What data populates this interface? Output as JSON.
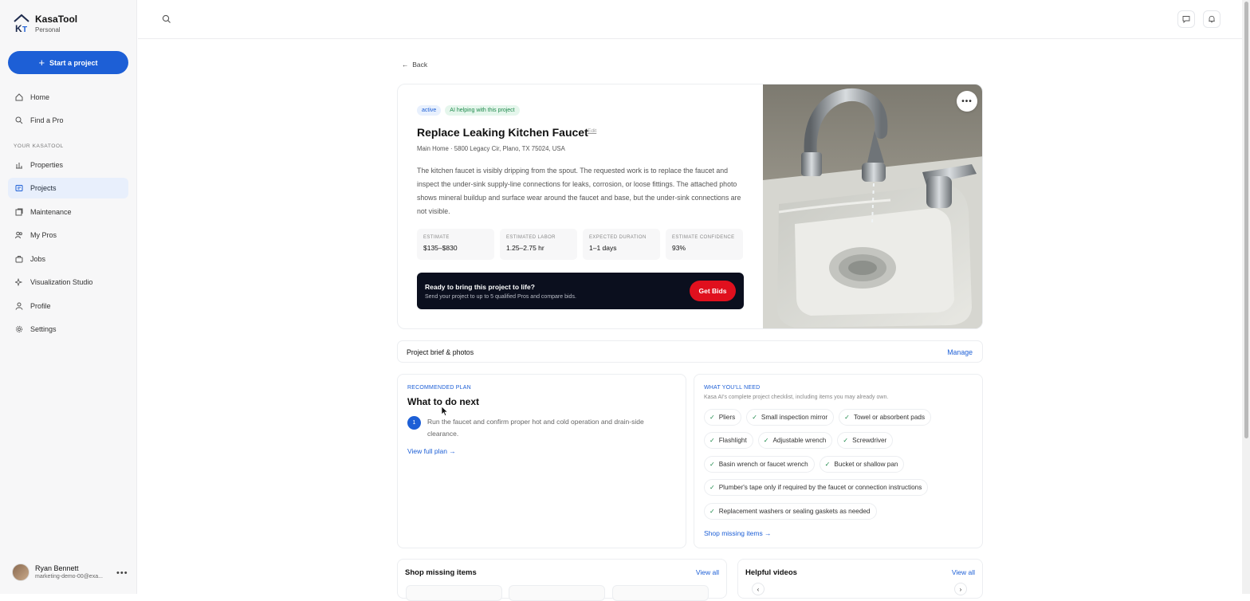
{
  "brand": {
    "name": "KasaTool",
    "subtitle": "Personal"
  },
  "sidebar": {
    "start_label": "Start a project",
    "section_label": "YOUR KASATOOL",
    "top_items": [
      {
        "label": "Home",
        "icon": "home-icon"
      },
      {
        "label": "Find a Pro",
        "icon": "search-icon"
      }
    ],
    "items": [
      {
        "label": "Properties",
        "icon": "chart-icon"
      },
      {
        "label": "Projects",
        "icon": "projects-icon",
        "active": true
      },
      {
        "label": "Maintenance",
        "icon": "maintenance-icon"
      },
      {
        "label": "My Pros",
        "icon": "users-icon"
      },
      {
        "label": "Jobs",
        "icon": "briefcase-icon"
      },
      {
        "label": "Visualization Studio",
        "icon": "sparkles-icon"
      },
      {
        "label": "Profile",
        "icon": "user-icon"
      },
      {
        "label": "Settings",
        "icon": "gear-icon"
      }
    ],
    "user": {
      "name": "Ryan Bennett",
      "email": "marketing-demo-00@exa..."
    }
  },
  "page": {
    "back_label": "Back",
    "badges": {
      "status": "active",
      "ai": "AI helping with this project"
    },
    "title": "Replace Leaking Kitchen Faucet",
    "edit_label": "Edit",
    "address": "Main Home · 5800 Legacy Cir, Plano, TX 75024, USA",
    "description": "The kitchen faucet is visibly dripping from the spout. The requested work is to replace the faucet and inspect the under-sink supply-line connections for leaks, corrosion, or loose fittings. The attached photo shows mineral buildup and surface wear around the faucet and base, but the under-sink connections are not visible.",
    "stats": [
      {
        "label": "ESTIMATE",
        "value": "$135–$830"
      },
      {
        "label": "ESTIMATED LABOR",
        "value": "1.25–2.75 hr"
      },
      {
        "label": "EXPECTED DURATION",
        "value": "1–1 days"
      },
      {
        "label": "ESTIMATE CONFIDENCE",
        "value": "93%"
      }
    ],
    "cta": {
      "title": "Ready to bring this project to life?",
      "subtitle": "Send your project to up to 5 qualified Pros and compare bids.",
      "button": "Get Bids"
    },
    "brief": {
      "title": "Project brief & photos",
      "action": "Manage"
    },
    "plan": {
      "kicker": "RECOMMENDED PLAN",
      "title": "What to do next",
      "step_number": "1",
      "step_text": "Run the faucet and confirm proper hot and cold operation and drain-side clearance.",
      "link": "View full plan →"
    },
    "needs": {
      "kicker": "WHAT YOU'LL NEED",
      "subtitle": "Kasa AI's complete project checklist, including items you may already own.",
      "rows": [
        [
          "Pliers",
          "Small inspection mirror",
          "Towel or absorbent pads"
        ],
        [
          "Flashlight",
          "Adjustable wrench",
          "Screwdriver"
        ],
        [
          "Basin wrench or faucet wrench",
          "Bucket or shallow pan"
        ],
        [
          "Plumber's tape only if required by the faucet or connection instructions"
        ],
        [
          "Replacement washers or sealing gaskets as needed"
        ]
      ],
      "check": "✓",
      "link": "Shop missing items →"
    },
    "shop": {
      "title": "Shop missing items",
      "link": "View all"
    },
    "videos": {
      "title": "Helpful videos",
      "link": "View all"
    }
  },
  "colors": {
    "accent": "#1d5fd6",
    "cta_bg": "#0b0f1e",
    "cta_button": "#e0101e",
    "success": "#1f8a4c"
  }
}
